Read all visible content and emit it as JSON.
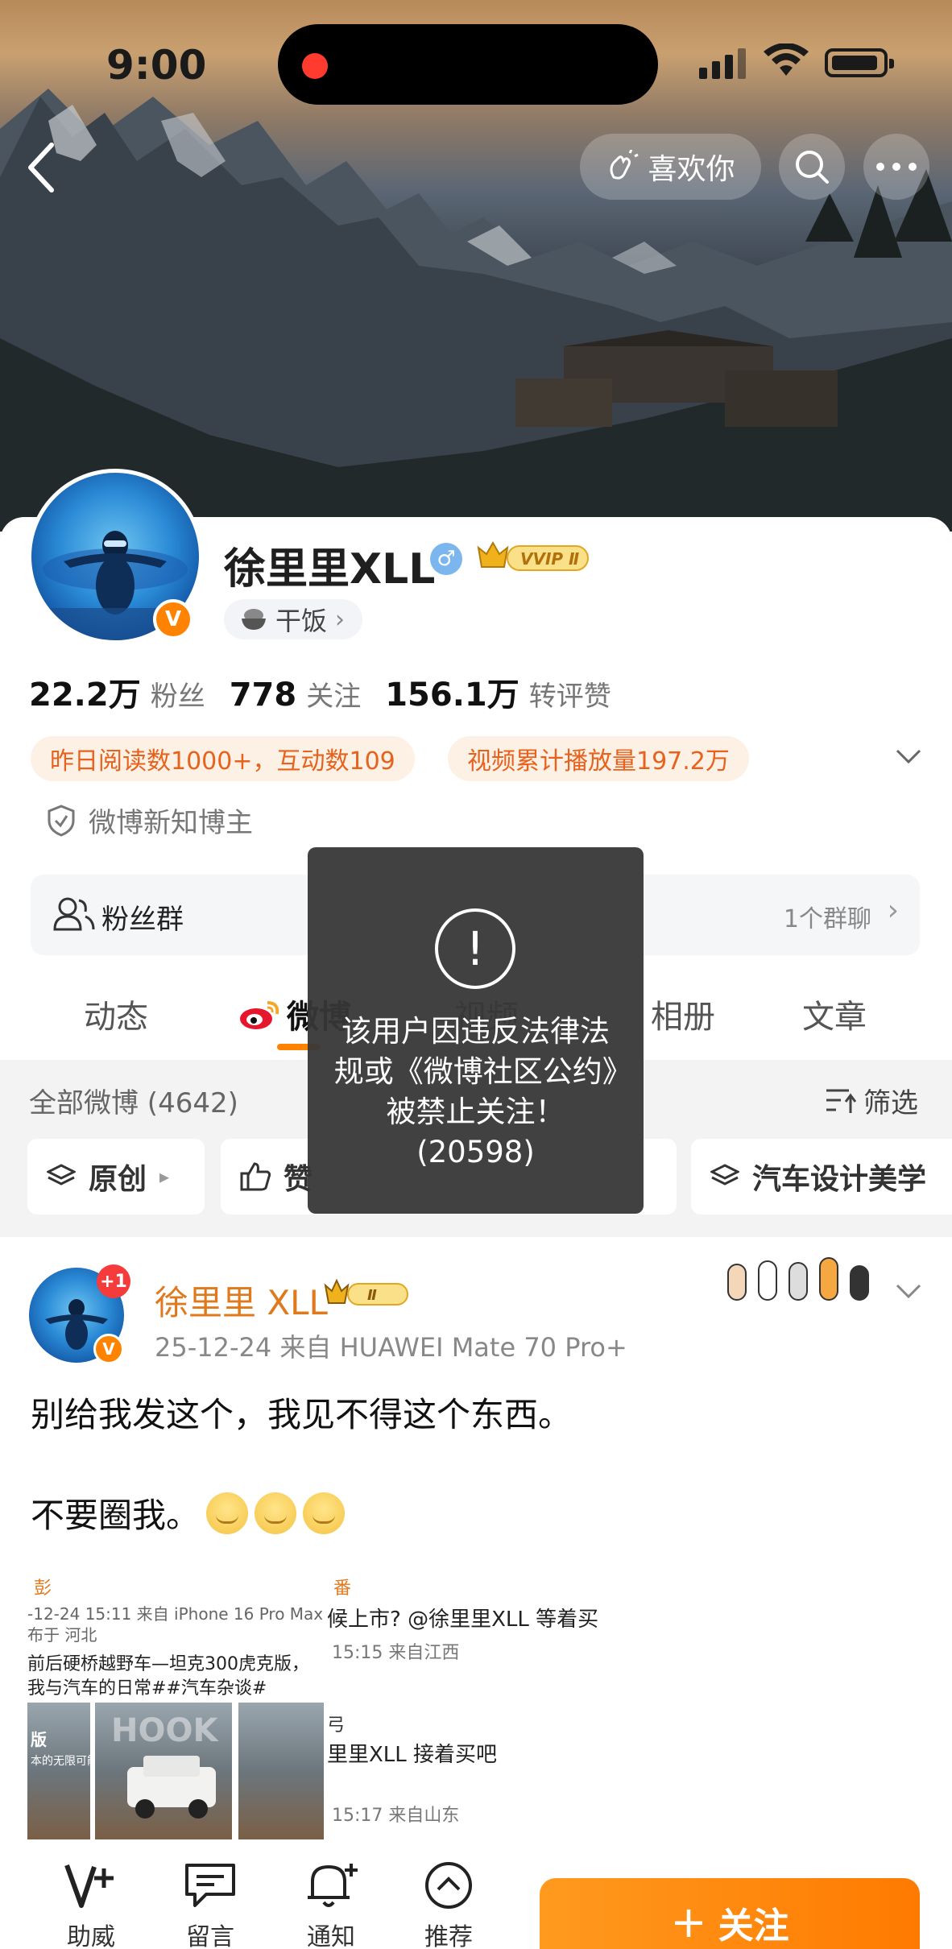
{
  "status_bar": {
    "time": "9:00"
  },
  "header": {
    "like_label": "喜欢你"
  },
  "profile": {
    "name": "徐里里XLL",
    "vip_label": "VVIP Ⅱ",
    "tag": "干饭",
    "stats": [
      {
        "value": "22.2万",
        "label": "粉丝"
      },
      {
        "value": "778",
        "label": "关注"
      },
      {
        "value": "156.1万",
        "label": "转评赞"
      }
    ],
    "highlights": [
      "昨日阅读数1000+，互动数109",
      "视频累计播放量197.2万"
    ],
    "verify_text": "微博新知博主",
    "fan_group": {
      "label": "粉丝群",
      "count": "1个群聊"
    }
  },
  "tabs": [
    {
      "label": "动态"
    },
    {
      "label": "微博"
    },
    {
      "label": "视频"
    },
    {
      "label": "相册"
    },
    {
      "label": "文章"
    }
  ],
  "filter": {
    "all_label": "全部微博 (4642)",
    "filter_label": "筛选"
  },
  "chips": [
    {
      "label": "原创"
    },
    {
      "label": "赞"
    },
    {
      "label": "汽车设计美学"
    }
  ],
  "toast": {
    "message": "该用户因违反法律法规或《微博社区公约》被禁止关注！(20598)"
  },
  "post": {
    "badge": "+1",
    "author": "徐里里 XLL",
    "meta": "25-12-24  来自 HUAWEI Mate 70 Pro+",
    "text_line1": "别给我发这个，我见不得这个东西。",
    "text_line2": "不要圈我。",
    "embedded": {
      "left_name": "彭",
      "left_meta": "-12-24 15:11  来自 iPhone 16 Pro Max",
      "left_loc": "布于 河北",
      "left_text1": "前后硬桥越野车—坦克300虎克版，",
      "left_text2": "我与汽车的日常##汽车杂谈#",
      "left_img_text": "版",
      "left_img_text2": "本的无限可能",
      "watermark": "HOOK",
      "c1_name": "番",
      "c1_text": "候上市? @徐里里XLL 等着买",
      "c1_meta": "15:15  来自江西",
      "c2_name": "弓",
      "c2_text": "里里XLL 接着买吧",
      "c2_meta": "15:17  来自山东"
    }
  },
  "bottom_bar": {
    "items": [
      {
        "label": "助威"
      },
      {
        "label": "留言"
      },
      {
        "label": "通知"
      },
      {
        "label": "推荐"
      }
    ],
    "follow_label": "关注"
  }
}
